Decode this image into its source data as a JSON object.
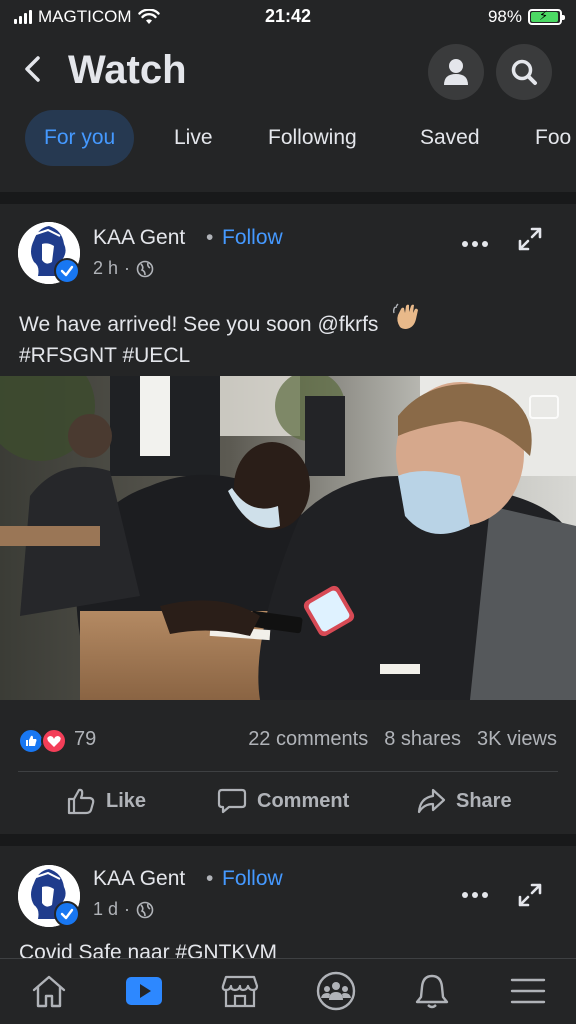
{
  "status_bar": {
    "carrier": "MAGTICOM",
    "time": "21:42",
    "battery": "98%"
  },
  "header": {
    "title": "Watch",
    "back_icon": "chevron-left-icon",
    "profile_icon": "person-icon",
    "search_icon": "search-icon"
  },
  "tabs": [
    {
      "label": "For you",
      "active": true
    },
    {
      "label": "Live",
      "active": false
    },
    {
      "label": "Following",
      "active": false
    },
    {
      "label": "Saved",
      "active": false
    },
    {
      "label": "Foo",
      "active": false
    }
  ],
  "posts": [
    {
      "page": "KAA Gent",
      "follow": "Follow",
      "time": "2 h",
      "text_line1": "We have arrived! See you soon @fkrfs",
      "text_line2": "#RFSGNT #UECL",
      "reaction_count": "79",
      "comments": "22 comments",
      "shares": "8 shares",
      "views": "3K views"
    },
    {
      "page": "KAA Gent",
      "follow": "Follow",
      "time": "1 d",
      "text_line1": "Covid Safe naar #GNTKVM"
    }
  ],
  "actions": {
    "like": "Like",
    "comment": "Comment",
    "share": "Share"
  },
  "colors": {
    "background": "#242526",
    "accent": "#4599ff",
    "separator": "#18191a"
  },
  "bottom_nav": [
    "home-icon",
    "watch-icon",
    "marketplace-icon",
    "groups-icon",
    "notifications-icon",
    "menu-icon"
  ]
}
